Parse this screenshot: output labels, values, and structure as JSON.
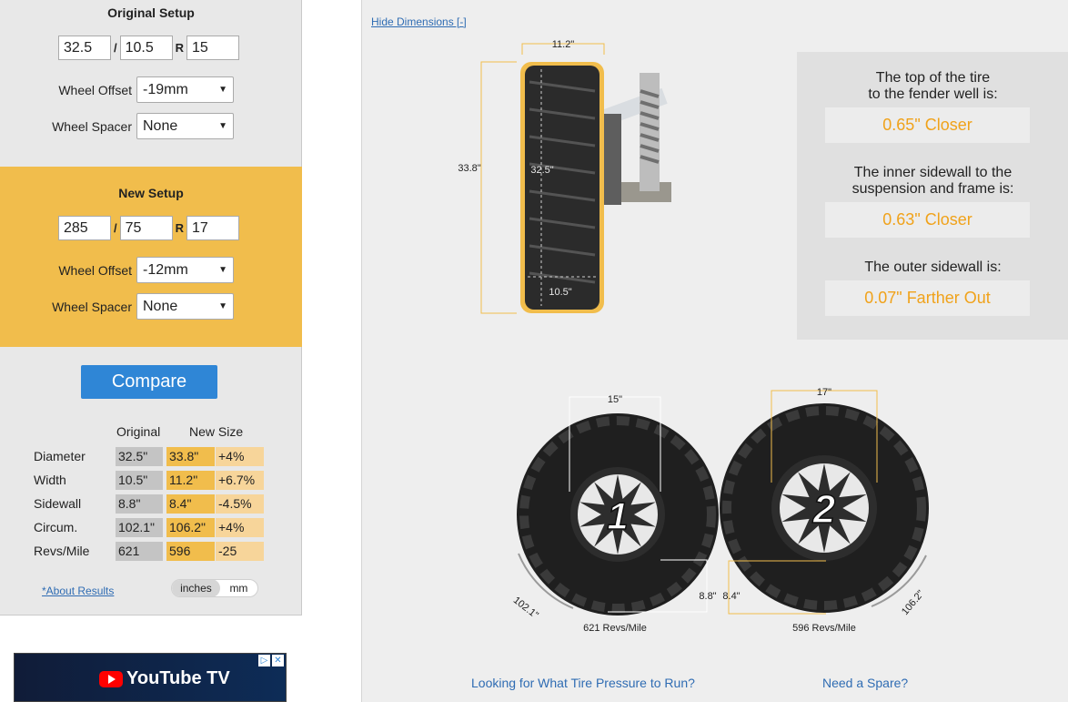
{
  "original_setup": {
    "title": "Original Setup",
    "width": "32.5",
    "sep1": "/",
    "ratio": "10.5",
    "sep2": "R",
    "rim": "15",
    "offset_label": "Wheel Offset",
    "offset_value": "-19mm",
    "spacer_label": "Wheel Spacer",
    "spacer_value": "None"
  },
  "new_setup": {
    "title": "New Setup",
    "width": "285",
    "sep1": "/",
    "ratio": "75",
    "sep2": "R",
    "rim": "17",
    "offset_label": "Wheel Offset",
    "offset_value": "-12mm",
    "spacer_label": "Wheel Spacer",
    "spacer_value": "None"
  },
  "compare_label": "Compare",
  "results": {
    "col_original": "Original",
    "col_new": "New Size",
    "rows": [
      {
        "label": "Diameter",
        "original": "32.5\"",
        "new": "33.8\"",
        "diff": "+4%"
      },
      {
        "label": "Width",
        "original": "10.5\"",
        "new": "11.2\"",
        "diff": "+6.7%"
      },
      {
        "label": "Sidewall",
        "original": "8.8\"",
        "new": "8.4\"",
        "diff": "-4.5%"
      },
      {
        "label": "Circum.",
        "original": "102.1\"",
        "new": "106.2\"",
        "diff": "+4%"
      },
      {
        "label": "Revs/Mile",
        "original": "621",
        "new": "596",
        "diff": "-25"
      }
    ]
  },
  "about_link": "*About Results",
  "unit_toggle": {
    "inches": "inches",
    "mm": "mm"
  },
  "ad": {
    "brand": "YouTube TV",
    "icons": [
      "ad-choices-icon",
      "close-icon"
    ]
  },
  "hide_dimensions": "Hide Dimensions [-]",
  "side_view": {
    "new_width": "11.2\"",
    "new_diameter": "33.8\"",
    "orig_diameter": "32.5\"",
    "orig_width": "10.5\""
  },
  "clearance": {
    "fender_text_1": "The top of the tire",
    "fender_text_2": "to the fender well is:",
    "fender_value": "0.65\" Closer",
    "inner_text_1": "The inner sidewall to the",
    "inner_text_2": "suspension and frame is:",
    "inner_value": "0.63\" Closer",
    "outer_text": "The outer sidewall is:",
    "outer_value": "0.07\" Farther Out"
  },
  "wheels": {
    "tire1": {
      "number": "1",
      "rim": "15\"",
      "sidewall": "8.8\"",
      "circumference": "102.1\"",
      "revs": "621 Revs/Mile"
    },
    "tire2": {
      "number": "2",
      "rim": "17\"",
      "sidewall": "8.4\"",
      "circumference": "106.2\"",
      "revs": "596 Revs/Mile"
    }
  },
  "links": {
    "pressure": "Looking for What Tire Pressure to Run?",
    "spare": "Need a Spare?"
  },
  "colors": {
    "accent": "#f1bd4c",
    "button": "#2f86d6",
    "value_text": "#f0a21a",
    "link": "#2f6cb3"
  }
}
